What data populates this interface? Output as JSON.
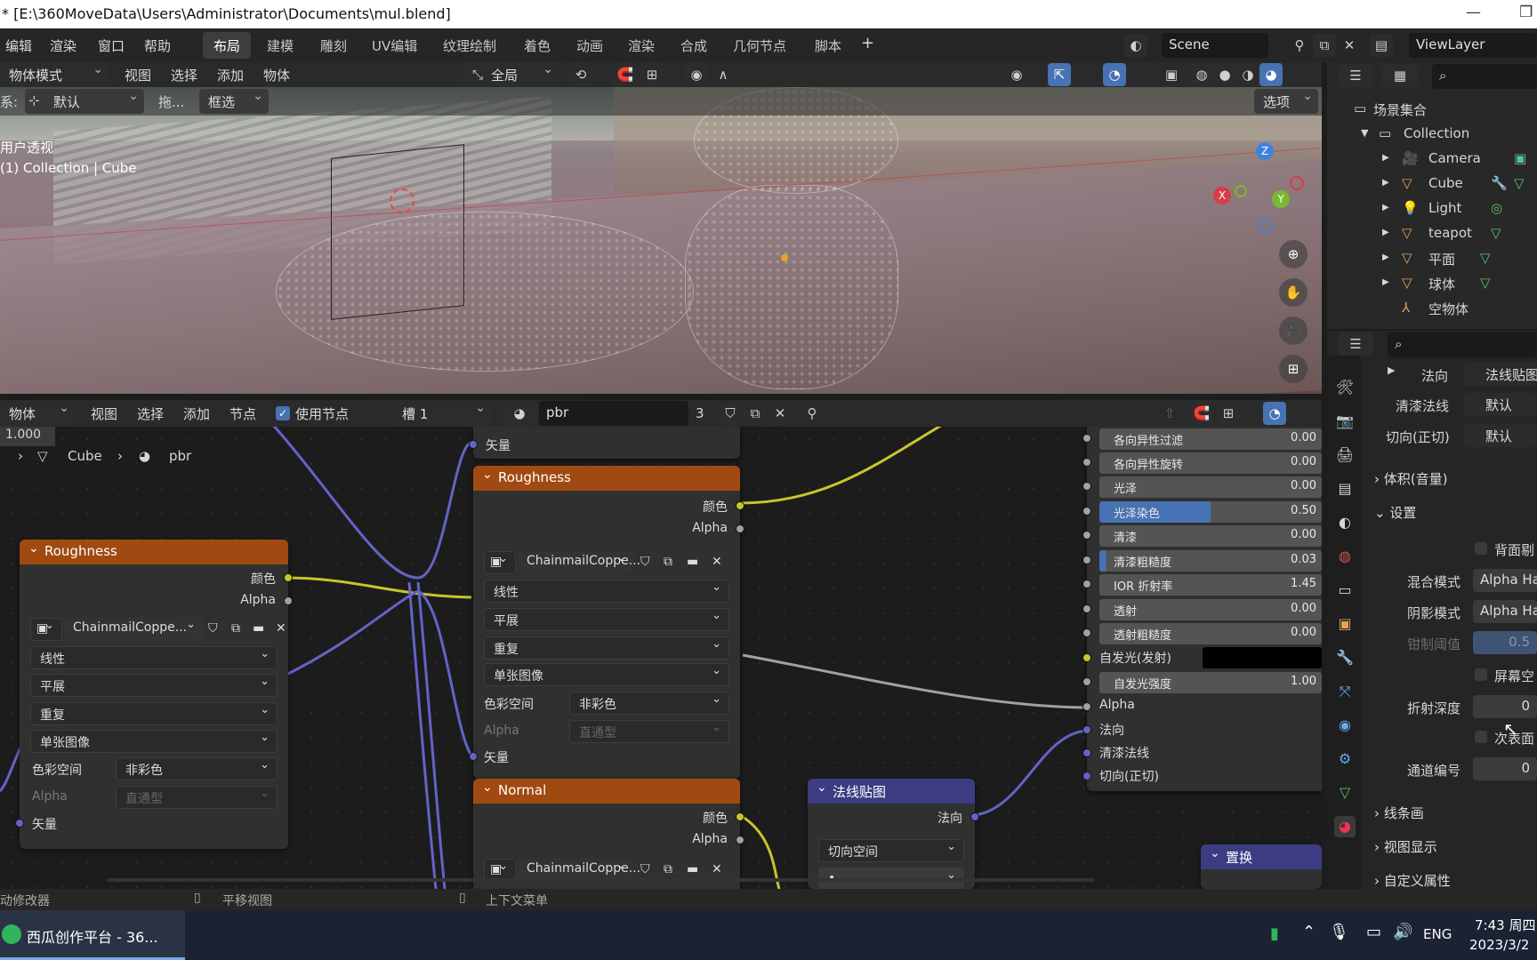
{
  "window": {
    "title": "* [E:\\360MoveData\\Users\\Administrator\\Documents\\mul.blend]"
  },
  "menu": {
    "items": [
      "编辑",
      "渲染",
      "窗口",
      "帮助"
    ]
  },
  "workspaces": [
    "布局",
    "建模",
    "雕刻",
    "UV编辑",
    "纹理绘制",
    "着色",
    "动画",
    "渲染",
    "合成",
    "几何节点",
    "脚本"
  ],
  "scene": {
    "name": "Scene",
    "view_layer": "ViewLayer"
  },
  "viewport_header": {
    "mode": "物体模式",
    "menus": [
      "视图",
      "选择",
      "添加",
      "物体"
    ],
    "transform": "全局"
  },
  "viewport_options": {
    "label": "系:",
    "orientation": "默认",
    "drag": "拖...",
    "select": "框选",
    "options": "选项"
  },
  "viewport": {
    "view_name": "用户透视",
    "collection_text": "(1) Collection | Cube"
  },
  "gizmo": {
    "x": "X",
    "y": "Y",
    "z": "Z"
  },
  "outliner": {
    "root": "场景集合",
    "collection": "Collection",
    "items": [
      "Camera",
      "Cube",
      "Light",
      "teapot",
      "平面",
      "球体",
      "空物体"
    ]
  },
  "node_header": {
    "type": "物体",
    "menus": [
      "视图",
      "选择",
      "添加",
      "节点"
    ],
    "use_nodes": "使用节点",
    "slot": "槽 1",
    "material": "pbr",
    "users": "3"
  },
  "breadcrumb": {
    "zoom": "1.000",
    "object": "Cube",
    "material": "pbr"
  },
  "node_left": {
    "title": "Roughness",
    "out_color": "颜色",
    "out_alpha": "Alpha",
    "image": "ChainmailCoppe...",
    "interp": "线性",
    "proj": "平展",
    "ext": "重复",
    "source": "单张图像",
    "cs_label": "色彩空间",
    "cs_value": "非彩色",
    "alpha_label": "Alpha",
    "alpha_value": "直通型",
    "in_vector": "矢量"
  },
  "node_mid": {
    "top_vector": "矢量",
    "title": "Roughness",
    "out_color": "颜色",
    "out_alpha": "Alpha",
    "image": "ChainmailCoppe...",
    "interp": "线性",
    "proj": "平展",
    "ext": "重复",
    "source": "单张图像",
    "cs_label": "色彩空间",
    "cs_value": "非彩色",
    "alpha_label": "Alpha",
    "alpha_value": "直通型",
    "in_vector": "矢量"
  },
  "node_normal": {
    "title": "Normal",
    "out_color": "颜色",
    "out_alpha": "Alpha",
    "image": "ChainmailCoppe..."
  },
  "node_normalmap": {
    "title": "法线贴图",
    "out": "法向",
    "space": "切向空间"
  },
  "node_disp": {
    "title": "置换"
  },
  "bsdf": {
    "rows": [
      {
        "label": "各向异性过滤",
        "value": "0.00"
      },
      {
        "label": "各向异性旋转",
        "value": "0.00"
      },
      {
        "label": "光泽",
        "value": "0.00"
      },
      {
        "label": "光泽染色",
        "value": "0.50"
      },
      {
        "label": "清漆",
        "value": "0.00"
      },
      {
        "label": "清漆粗糙度",
        "value": "0.03"
      },
      {
        "label": "IOR 折射率",
        "value": "1.45"
      },
      {
        "label": "透射",
        "value": "0.00"
      },
      {
        "label": "透射粗糙度",
        "value": "0.00"
      }
    ],
    "emission": "自发光(发射)",
    "emission_strength": {
      "label": "自发光强度",
      "value": "1.00"
    },
    "inputs": [
      "Alpha",
      "法向",
      "清漆法线",
      "切向(正切)"
    ]
  },
  "props": {
    "normal_label": "法向",
    "normal_value": "法线贴图",
    "coat_label": "清漆法线",
    "coat_value": "默认",
    "tangent_label": "切向(正切)",
    "tangent_value": "默认",
    "volume": "体积(音量)",
    "settings": "设置",
    "backface": "背面剔",
    "blend_label": "混合模式",
    "blend_value": "Alpha Ha",
    "shadow_label": "阴影模式",
    "shadow_value": "Alpha Ha",
    "clip_label": "钳制阈值",
    "clip_value": "0.5",
    "screen": "屏幕空",
    "refr_label": "折射深度",
    "refr_value": "0 ",
    "sub": "次表面",
    "pass_label": "通道编号",
    "pass_value": "0",
    "lineart": "线条画",
    "viewport_display": "视图显示",
    "custom": "自定义属性"
  },
  "statusbar": {
    "left": "动修改器",
    "pan": "平移视图",
    "ctx": "上下文菜单"
  },
  "taskbar": {
    "app": "西瓜创作平台 - 36...",
    "lang": "ENG",
    "time": "7:43 周四",
    "date": "2023/3/2"
  }
}
